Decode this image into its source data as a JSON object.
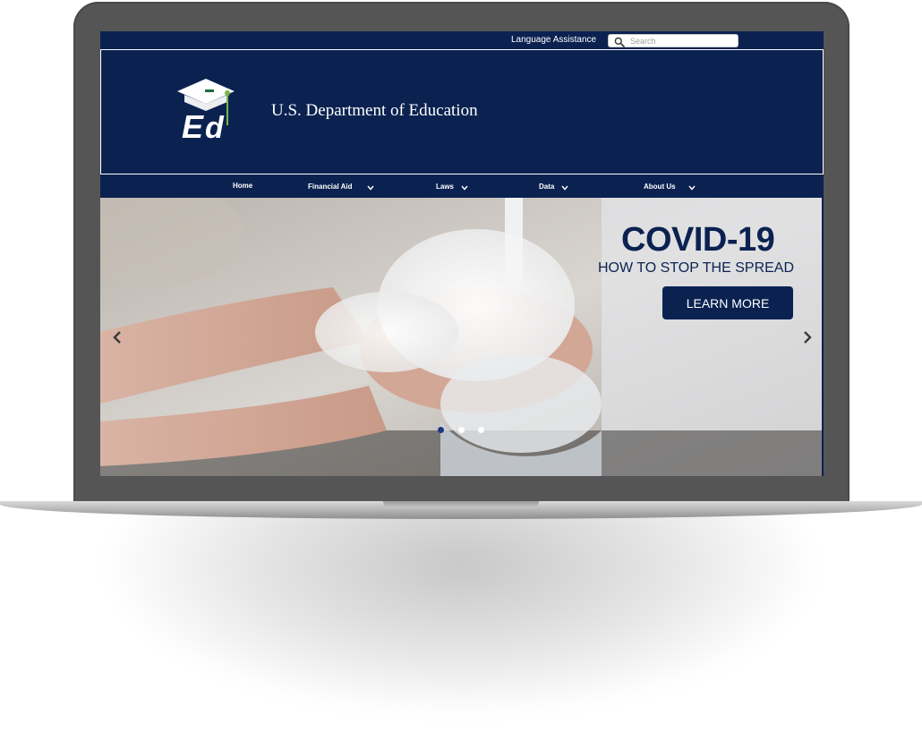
{
  "utility": {
    "language_label": "Language Assistance",
    "search_placeholder": "Search"
  },
  "header": {
    "title": "U.S. Department of Education",
    "logo_text": "Ed"
  },
  "nav": {
    "items": [
      {
        "label": "Home",
        "has_dropdown": false
      },
      {
        "label": "Financial Aid",
        "has_dropdown": true
      },
      {
        "label": "Laws",
        "has_dropdown": true
      },
      {
        "label": "Data",
        "has_dropdown": true
      },
      {
        "label": "About Us",
        "has_dropdown": true
      }
    ]
  },
  "hero": {
    "title": "COVID-19",
    "subtitle": "HOW TO STOP THE SPREAD",
    "button_label": "LEARN MORE",
    "slide_count": 3,
    "active_slide": 1
  },
  "colors": {
    "brand_navy": "#0b2251",
    "frame_gray": "#555555",
    "logo_green": "#7ab648"
  }
}
